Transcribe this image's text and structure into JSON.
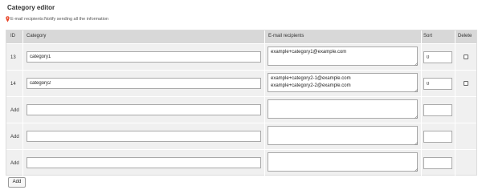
{
  "page": {
    "title": "Category editor",
    "hint": "E-mail recipients:Notify sending all the information",
    "hint_icon": "pin-icon",
    "accent_color": "#e8462a"
  },
  "table": {
    "headers": {
      "id": "ID",
      "category": "Category",
      "email": "E-mail recipients",
      "sort": "Sort",
      "delete": "Delete"
    },
    "rows": [
      {
        "id": "13",
        "category": "category1",
        "email": "example+category1@example.com",
        "sort": "0",
        "has_delete": true
      },
      {
        "id": "14",
        "category": "category2",
        "email": "example+category2-1@example.com\nexample+category2-2@example.com",
        "sort": "0",
        "has_delete": true
      },
      {
        "id": "Add",
        "category": "",
        "email": "",
        "sort": "",
        "has_delete": false
      },
      {
        "id": "Add",
        "category": "",
        "email": "",
        "sort": "",
        "has_delete": false
      },
      {
        "id": "Add",
        "category": "",
        "email": "",
        "sort": "",
        "has_delete": false
      }
    ]
  },
  "footer": {
    "add_label": "Add"
  }
}
